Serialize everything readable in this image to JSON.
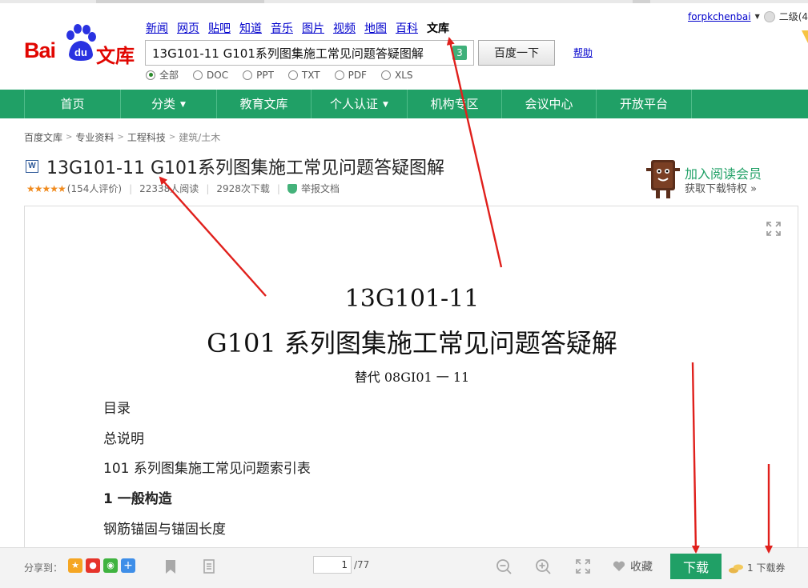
{
  "header": {
    "logo_left": "Bai",
    "logo_paw_text": "du",
    "logo_right": "文库",
    "topnav": [
      "新闻",
      "网页",
      "贴吧",
      "知道",
      "音乐",
      "图片",
      "视频",
      "地图",
      "百科",
      "文库"
    ],
    "search_value": "13G101-11 G101系列图集施工常见问题答疑图解",
    "search_count": "3",
    "search_button": "百度一下",
    "help": "帮助",
    "filetypes": [
      "全部",
      "DOC",
      "PPT",
      "TXT",
      "PDF",
      "XLS"
    ],
    "username": "forpkchenbai",
    "level": "二级(4"
  },
  "mainnav": [
    "首页",
    "分类",
    "教育文库",
    "个人认证",
    "机构专区",
    "会议中心",
    "开放平台"
  ],
  "breadcrumb": [
    "百度文库",
    "专业资料",
    "工程科技",
    "建筑/土木"
  ],
  "document": {
    "type_icon": "W",
    "title": "13G101-11 G101系列图集施工常见问题答疑图解",
    "stars": "★★★★★",
    "ratings": "(154人评价)",
    "reads": "22338人阅读",
    "downloads": "2928次下载",
    "report": "举报文档"
  },
  "vip": {
    "title": "加入阅读会员",
    "subtitle": "获取下载特权 »"
  },
  "page_content": {
    "heading1": "13G101-11",
    "heading2": "G101 系列图集施工常见问题答疑解",
    "replaces": "替代 08GI01 一 11",
    "lines": [
      "目录",
      "总说明",
      "101 系列图集施工常见问题索引表",
      "1 一般构造",
      "钢筋锚固与锚固长度"
    ]
  },
  "toolbar": {
    "share_label": "分享到：",
    "page_current": "1",
    "page_total": "/77",
    "collect": "收藏",
    "download": "下载",
    "coupon": "1 下载券"
  },
  "colors": {
    "accent_green": "#20a066",
    "baidu_red": "#e10601",
    "link_blue": "#0000cc",
    "annotation_red": "#e0201c"
  }
}
